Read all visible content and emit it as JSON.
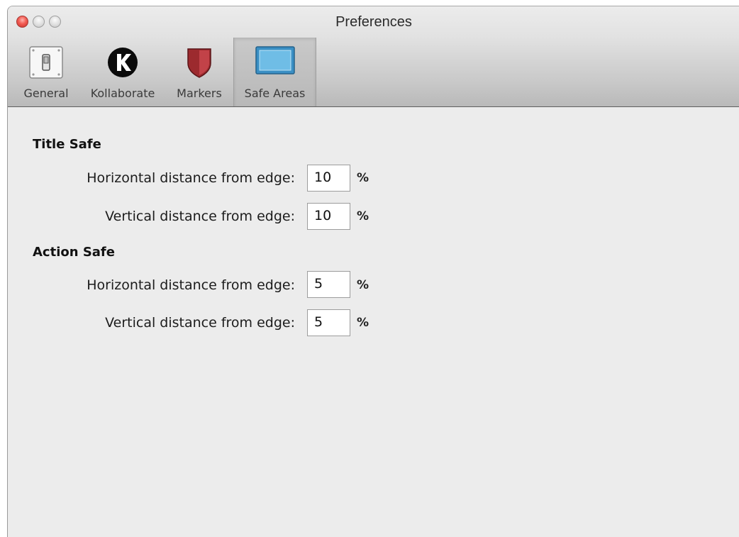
{
  "window": {
    "title": "Preferences",
    "traffic_lights": [
      "close",
      "minimize",
      "zoom"
    ]
  },
  "toolbar": {
    "tabs": [
      {
        "label": "General",
        "icon": "light-switch-icon",
        "selected": false
      },
      {
        "label": "Kollaborate",
        "icon": "kollaborate-logo-icon",
        "selected": false
      },
      {
        "label": "Markers",
        "icon": "shield-marker-icon",
        "selected": false
      },
      {
        "label": "Safe Areas",
        "icon": "safe-area-frame-icon",
        "selected": true
      }
    ]
  },
  "title_safe": {
    "heading": "Title Safe",
    "horizontal_label": "Horizontal distance from edge:",
    "horizontal_value": "10",
    "vertical_label": "Vertical distance from edge:",
    "vertical_value": "10",
    "unit": "%"
  },
  "action_safe": {
    "heading": "Action Safe",
    "horizontal_label": "Horizontal distance from edge:",
    "horizontal_value": "5",
    "vertical_label": "Vertical distance from edge:",
    "vertical_value": "5",
    "unit": "%"
  },
  "colors": {
    "close_light": "#f25b52",
    "selected_tab_icon": "#4aa3d6",
    "marker_icon": "#9c2a2e"
  }
}
